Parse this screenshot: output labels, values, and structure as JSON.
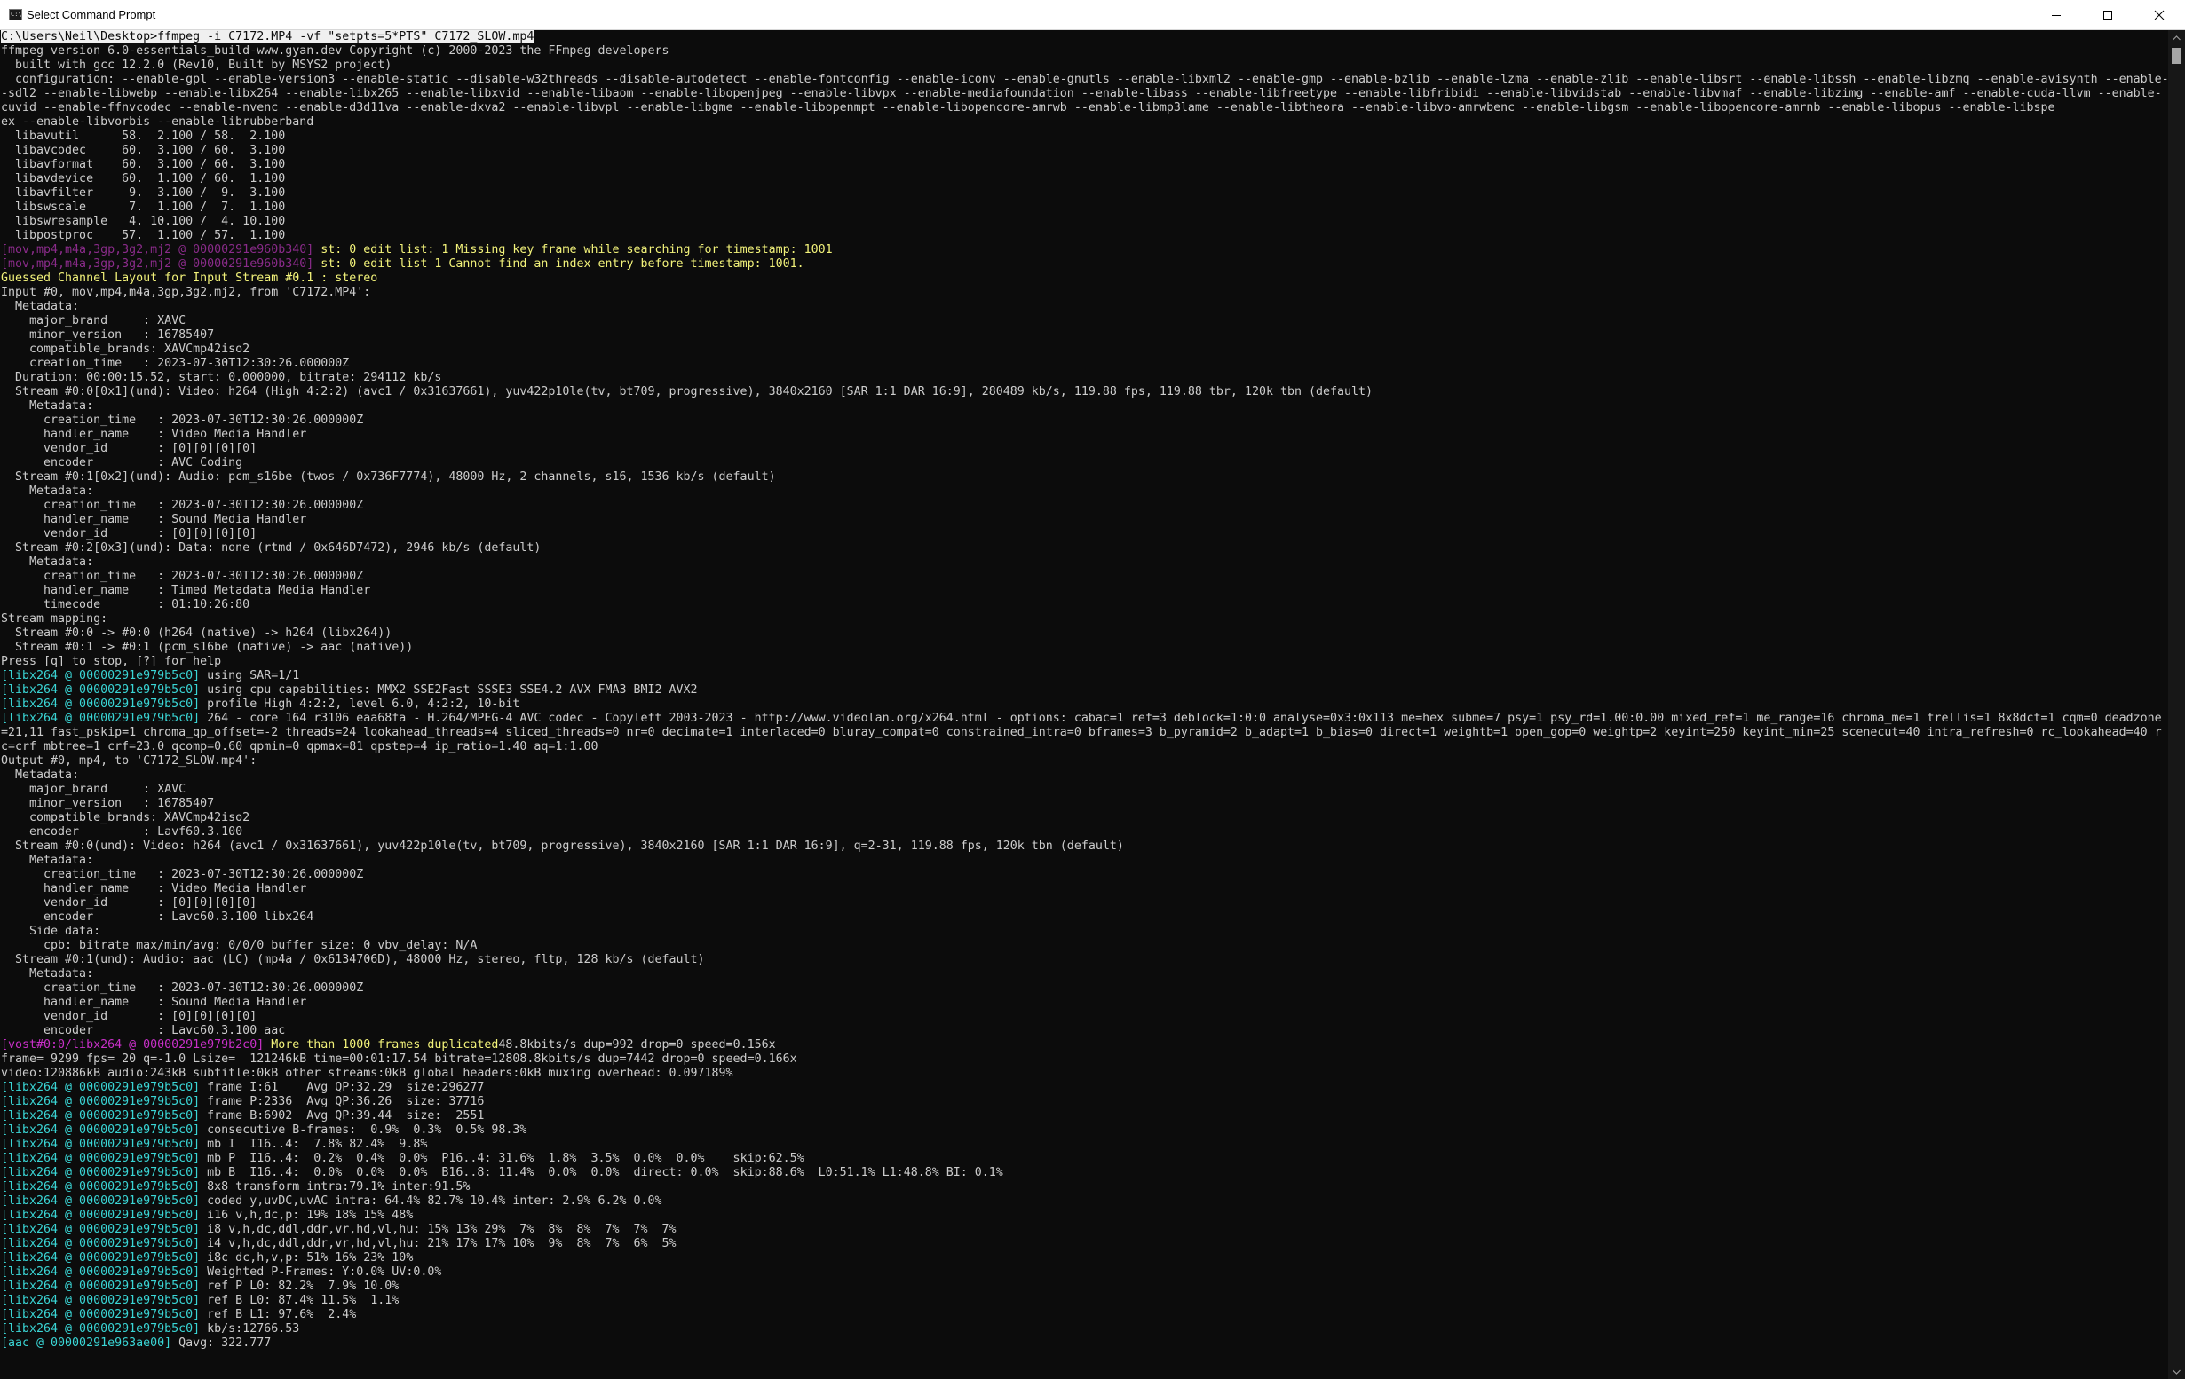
{
  "window": {
    "title": "Select Command Prompt",
    "app_icon_text": "C:\\",
    "icons": {
      "minimize": "minimize-icon",
      "maximize": "maximize-icon",
      "close": "close-icon",
      "scroll_up": "chevron-up-icon",
      "scroll_down": "chevron-down-icon"
    },
    "scrollbar_position_fraction": 0.0
  },
  "colors": {
    "background": "#0c0c0c",
    "text": "#cccccc",
    "tag_cyan": "#3ad5d5",
    "tag_purple": "#8a2b8a",
    "tag_magenta": "#c930c9",
    "warning_yellow": "#f2f27a",
    "selection": "#f0f0f0"
  },
  "console": {
    "lines": [
      [
        {
          "t": "C:\\Users\\Neil\\Desktop>ffmpeg -i C7172.MP4 -vf \"setpts=5*PTS\" C7172_SLOW.mp4",
          "c": "prompt"
        }
      ],
      [
        {
          "t": "ffmpeg version 6.0-essentials_build-www.gyan.dev Copyright (c) 2000-2023 the FFmpeg developers",
          "c": "normal"
        }
      ],
      [
        {
          "t": "  built with gcc 12.2.0 (Rev10, Built by MSYS2 project)",
          "c": "normal"
        }
      ],
      [
        {
          "t": "  configuration: --enable-gpl --enable-version3 --enable-static --disable-w32threads --disable-autodetect --enable-fontconfig --enable-iconv --enable-gnutls --enable-libxml2 --enable-gmp --enable-bzlib --enable-lzma --enable-zlib --enable-libsrt --enable-libssh --enable-libzmq --enable-avisynth --enable-",
          "c": "normal"
        }
      ],
      [
        {
          "t": "-sdl2 --enable-libwebp --enable-libx264 --enable-libx265 --enable-libxvid --enable-libaom --enable-libopenjpeg --enable-libvpx --enable-mediafoundation --enable-libass --enable-libfreetype --enable-libfribidi --enable-libvidstab --enable-libvmaf --enable-libzimg --enable-amf --enable-cuda-llvm --enable-",
          "c": "normal"
        }
      ],
      [
        {
          "t": "cuvid --enable-ffnvcodec --enable-nvenc --enable-d3d11va --enable-dxva2 --enable-libvpl --enable-libgme --enable-libopenmpt --enable-libopencore-amrwb --enable-libmp3lame --enable-libtheora --enable-libvo-amrwbenc --enable-libgsm --enable-libopencore-amrnb --enable-libopus --enable-libspe",
          "c": "normal"
        }
      ],
      [
        {
          "t": "ex --enable-libvorbis --enable-librubberband",
          "c": "normal"
        }
      ],
      [
        {
          "t": "  libavutil      58.  2.100 / 58.  2.100",
          "c": "normal"
        }
      ],
      [
        {
          "t": "  libavcodec     60.  3.100 / 60.  3.100",
          "c": "normal"
        }
      ],
      [
        {
          "t": "  libavformat    60.  3.100 / 60.  3.100",
          "c": "normal"
        }
      ],
      [
        {
          "t": "  libavdevice    60.  1.100 / 60.  1.100",
          "c": "normal"
        }
      ],
      [
        {
          "t": "  libavfilter     9.  3.100 /  9.  3.100",
          "c": "normal"
        }
      ],
      [
        {
          "t": "  libswscale      7.  1.100 /  7.  1.100",
          "c": "normal"
        }
      ],
      [
        {
          "t": "  libswresample   4. 10.100 /  4. 10.100",
          "c": "normal"
        }
      ],
      [
        {
          "t": "  libpostproc    57.  1.100 / 57.  1.100",
          "c": "normal"
        }
      ],
      [
        {
          "t": "[mov,mp4,m4a,3gp,3g2,mj2 @ 00000291e960b340]",
          "c": "purple"
        },
        {
          "t": " st: 0 edit list: 1 Missing key frame while searching for timestamp: 1001",
          "c": "yellow"
        }
      ],
      [
        {
          "t": "[mov,mp4,m4a,3gp,3g2,mj2 @ 00000291e960b340]",
          "c": "purple"
        },
        {
          "t": " st: 0 edit list 1 Cannot find an index entry before timestamp: 1001.",
          "c": "yellow"
        }
      ],
      [
        {
          "t": "Guessed Channel Layout for Input Stream #0.1 : stereo",
          "c": "yellow"
        }
      ],
      [
        {
          "t": "Input #0, mov,mp4,m4a,3gp,3g2,mj2, from 'C7172.MP4':",
          "c": "normal"
        }
      ],
      [
        {
          "t": "  Metadata:",
          "c": "normal"
        }
      ],
      [
        {
          "t": "    major_brand     : XAVC",
          "c": "normal"
        }
      ],
      [
        {
          "t": "    minor_version   : 16785407",
          "c": "normal"
        }
      ],
      [
        {
          "t": "    compatible_brands: XAVCmp42iso2",
          "c": "normal"
        }
      ],
      [
        {
          "t": "    creation_time   : 2023-07-30T12:30:26.000000Z",
          "c": "normal"
        }
      ],
      [
        {
          "t": "  Duration: 00:00:15.52, start: 0.000000, bitrate: 294112 kb/s",
          "c": "normal"
        }
      ],
      [
        {
          "t": "  Stream #0:0[0x1](und): Video: h264 (High 4:2:2) (avc1 / 0x31637661), yuv422p10le(tv, bt709, progressive), 3840x2160 [SAR 1:1 DAR 16:9], 280489 kb/s, 119.88 fps, 119.88 tbr, 120k tbn (default)",
          "c": "normal"
        }
      ],
      [
        {
          "t": "    Metadata:",
          "c": "normal"
        }
      ],
      [
        {
          "t": "      creation_time   : 2023-07-30T12:30:26.000000Z",
          "c": "normal"
        }
      ],
      [
        {
          "t": "      handler_name    : Video Media Handler",
          "c": "normal"
        }
      ],
      [
        {
          "t": "      vendor_id       : [0][0][0][0]",
          "c": "normal"
        }
      ],
      [
        {
          "t": "      encoder         : AVC Coding",
          "c": "normal"
        }
      ],
      [
        {
          "t": "  Stream #0:1[0x2](und): Audio: pcm_s16be (twos / 0x736F7774), 48000 Hz, 2 channels, s16, 1536 kb/s (default)",
          "c": "normal"
        }
      ],
      [
        {
          "t": "    Metadata:",
          "c": "normal"
        }
      ],
      [
        {
          "t": "      creation_time   : 2023-07-30T12:30:26.000000Z",
          "c": "normal"
        }
      ],
      [
        {
          "t": "      handler_name    : Sound Media Handler",
          "c": "normal"
        }
      ],
      [
        {
          "t": "      vendor_id       : [0][0][0][0]",
          "c": "normal"
        }
      ],
      [
        {
          "t": "  Stream #0:2[0x3](und): Data: none (rtmd / 0x646D7472), 2946 kb/s (default)",
          "c": "normal"
        }
      ],
      [
        {
          "t": "    Metadata:",
          "c": "normal"
        }
      ],
      [
        {
          "t": "      creation_time   : 2023-07-30T12:30:26.000000Z",
          "c": "normal"
        }
      ],
      [
        {
          "t": "      handler_name    : Timed Metadata Media Handler",
          "c": "normal"
        }
      ],
      [
        {
          "t": "      timecode        : 01:10:26:80",
          "c": "normal"
        }
      ],
      [
        {
          "t": "Stream mapping:",
          "c": "normal"
        }
      ],
      [
        {
          "t": "  Stream #0:0 -> #0:0 (h264 (native) -> h264 (libx264))",
          "c": "normal"
        }
      ],
      [
        {
          "t": "  Stream #0:1 -> #0:1 (pcm_s16be (native) -> aac (native))",
          "c": "normal"
        }
      ],
      [
        {
          "t": "Press [q] to stop, [?] for help",
          "c": "normal"
        }
      ],
      [
        {
          "t": "[libx264 @ 00000291e979b5c0]",
          "c": "cyan"
        },
        {
          "t": " using SAR=1/1",
          "c": "normal"
        }
      ],
      [
        {
          "t": "[libx264 @ 00000291e979b5c0]",
          "c": "cyan"
        },
        {
          "t": " using cpu capabilities: MMX2 SSE2Fast SSSE3 SSE4.2 AVX FMA3 BMI2 AVX2",
          "c": "normal"
        }
      ],
      [
        {
          "t": "[libx264 @ 00000291e979b5c0]",
          "c": "cyan"
        },
        {
          "t": " profile High 4:2:2, level 6.0, 4:2:2, 10-bit",
          "c": "normal"
        }
      ],
      [
        {
          "t": "[libx264 @ 00000291e979b5c0]",
          "c": "cyan"
        },
        {
          "t": " 264 - core 164 r3106 eaa68fa - H.264/MPEG-4 AVC codec - Copyleft 2003-2023 - http://www.videolan.org/x264.html - options: cabac=1 ref=3 deblock=1:0:0 analyse=0x3:0x113 me=hex subme=7 psy=1 psy_rd=1.00:0.00 mixed_ref=1 me_range=16 chroma_me=1 trellis=1 8x8dct=1 cqm=0 deadzone",
          "c": "normal"
        }
      ],
      [
        {
          "t": "=21,11 fast_pskip=1 chroma_qp_offset=-2 threads=24 lookahead_threads=4 sliced_threads=0 nr=0 decimate=1 interlaced=0 bluray_compat=0 constrained_intra=0 bframes=3 b_pyramid=2 b_adapt=1 b_bias=0 direct=1 weightb=1 open_gop=0 weightp=2 keyint=250 keyint_min=25 scenecut=40 intra_refresh=0 rc_lookahead=40 r",
          "c": "normal"
        }
      ],
      [
        {
          "t": "c=crf mbtree=1 crf=23.0 qcomp=0.60 qpmin=0 qpmax=81 qpstep=4 ip_ratio=1.40 aq=1:1.00",
          "c": "normal"
        }
      ],
      [
        {
          "t": "Output #0, mp4, to 'C7172_SLOW.mp4':",
          "c": "normal"
        }
      ],
      [
        {
          "t": "  Metadata:",
          "c": "normal"
        }
      ],
      [
        {
          "t": "    major_brand     : XAVC",
          "c": "normal"
        }
      ],
      [
        {
          "t": "    minor_version   : 16785407",
          "c": "normal"
        }
      ],
      [
        {
          "t": "    compatible_brands: XAVCmp42iso2",
          "c": "normal"
        }
      ],
      [
        {
          "t": "    encoder         : Lavf60.3.100",
          "c": "normal"
        }
      ],
      [
        {
          "t": "  Stream #0:0(und): Video: h264 (avc1 / 0x31637661), yuv422p10le(tv, bt709, progressive), 3840x2160 [SAR 1:1 DAR 16:9], q=2-31, 119.88 fps, 120k tbn (default)",
          "c": "normal"
        }
      ],
      [
        {
          "t": "    Metadata:",
          "c": "normal"
        }
      ],
      [
        {
          "t": "      creation_time   : 2023-07-30T12:30:26.000000Z",
          "c": "normal"
        }
      ],
      [
        {
          "t": "      handler_name    : Video Media Handler",
          "c": "normal"
        }
      ],
      [
        {
          "t": "      vendor_id       : [0][0][0][0]",
          "c": "normal"
        }
      ],
      [
        {
          "t": "      encoder         : Lavc60.3.100 libx264",
          "c": "normal"
        }
      ],
      [
        {
          "t": "    Side data:",
          "c": "normal"
        }
      ],
      [
        {
          "t": "      cpb: bitrate max/min/avg: 0/0/0 buffer size: 0 vbv_delay: N/A",
          "c": "normal"
        }
      ],
      [
        {
          "t": "  Stream #0:1(und): Audio: aac (LC) (mp4a / 0x6134706D), 48000 Hz, stereo, fltp, 128 kb/s (default)",
          "c": "normal"
        }
      ],
      [
        {
          "t": "    Metadata:",
          "c": "normal"
        }
      ],
      [
        {
          "t": "      creation_time   : 2023-07-30T12:30:26.000000Z",
          "c": "normal"
        }
      ],
      [
        {
          "t": "      handler_name    : Sound Media Handler",
          "c": "normal"
        }
      ],
      [
        {
          "t": "      vendor_id       : [0][0][0][0]",
          "c": "normal"
        }
      ],
      [
        {
          "t": "      encoder         : Lavc60.3.100 aac",
          "c": "normal"
        }
      ],
      [
        {
          "t": "[vost#0:0/libx264 @ 00000291e979b2c0]",
          "c": "magenta"
        },
        {
          "t": " More than 1000 frames duplicated",
          "c": "yellow"
        },
        {
          "t": "48.8kbits/s dup=992 drop=0 speed=0.156x",
          "c": "normal"
        }
      ],
      [
        {
          "t": "frame= 9299 fps= 20 q=-1.0 Lsize=  121246kB time=00:01:17.54 bitrate=12808.8kbits/s dup=7442 drop=0 speed=0.166x",
          "c": "normal"
        }
      ],
      [
        {
          "t": "video:120886kB audio:243kB subtitle:0kB other streams:0kB global headers:0kB muxing overhead: 0.097189%",
          "c": "normal"
        }
      ],
      [
        {
          "t": "[libx264 @ 00000291e979b5c0]",
          "c": "cyan"
        },
        {
          "t": " frame I:61    Avg QP:32.29  size:296277",
          "c": "normal"
        }
      ],
      [
        {
          "t": "[libx264 @ 00000291e979b5c0]",
          "c": "cyan"
        },
        {
          "t": " frame P:2336  Avg QP:36.26  size: 37716",
          "c": "normal"
        }
      ],
      [
        {
          "t": "[libx264 @ 00000291e979b5c0]",
          "c": "cyan"
        },
        {
          "t": " frame B:6902  Avg QP:39.44  size:  2551",
          "c": "normal"
        }
      ],
      [
        {
          "t": "[libx264 @ 00000291e979b5c0]",
          "c": "cyan"
        },
        {
          "t": " consecutive B-frames:  0.9%  0.3%  0.5% 98.3%",
          "c": "normal"
        }
      ],
      [
        {
          "t": "[libx264 @ 00000291e979b5c0]",
          "c": "cyan"
        },
        {
          "t": " mb I  I16..4:  7.8% 82.4%  9.8%",
          "c": "normal"
        }
      ],
      [
        {
          "t": "[libx264 @ 00000291e979b5c0]",
          "c": "cyan"
        },
        {
          "t": " mb P  I16..4:  0.2%  0.4%  0.0%  P16..4: 31.6%  1.8%  3.5%  0.0%  0.0%    skip:62.5%",
          "c": "normal"
        }
      ],
      [
        {
          "t": "[libx264 @ 00000291e979b5c0]",
          "c": "cyan"
        },
        {
          "t": " mb B  I16..4:  0.0%  0.0%  0.0%  B16..8: 11.4%  0.0%  0.0%  direct: 0.0%  skip:88.6%  L0:51.1% L1:48.8% BI: 0.1%",
          "c": "normal"
        }
      ],
      [
        {
          "t": "[libx264 @ 00000291e979b5c0]",
          "c": "cyan"
        },
        {
          "t": " 8x8 transform intra:79.1% inter:91.5%",
          "c": "normal"
        }
      ],
      [
        {
          "t": "[libx264 @ 00000291e979b5c0]",
          "c": "cyan"
        },
        {
          "t": " coded y,uvDC,uvAC intra: 64.4% 82.7% 10.4% inter: 2.9% 6.2% 0.0%",
          "c": "normal"
        }
      ],
      [
        {
          "t": "[libx264 @ 00000291e979b5c0]",
          "c": "cyan"
        },
        {
          "t": " i16 v,h,dc,p: 19% 18% 15% 48%",
          "c": "normal"
        }
      ],
      [
        {
          "t": "[libx264 @ 00000291e979b5c0]",
          "c": "cyan"
        },
        {
          "t": " i8 v,h,dc,ddl,ddr,vr,hd,vl,hu: 15% 13% 29%  7%  8%  8%  7%  7%  7%",
          "c": "normal"
        }
      ],
      [
        {
          "t": "[libx264 @ 00000291e979b5c0]",
          "c": "cyan"
        },
        {
          "t": " i4 v,h,dc,ddl,ddr,vr,hd,vl,hu: 21% 17% 17% 10%  9%  8%  7%  6%  5%",
          "c": "normal"
        }
      ],
      [
        {
          "t": "[libx264 @ 00000291e979b5c0]",
          "c": "cyan"
        },
        {
          "t": " i8c dc,h,v,p: 51% 16% 23% 10%",
          "c": "normal"
        }
      ],
      [
        {
          "t": "[libx264 @ 00000291e979b5c0]",
          "c": "cyan"
        },
        {
          "t": " Weighted P-Frames: Y:0.0% UV:0.0%",
          "c": "normal"
        }
      ],
      [
        {
          "t": "[libx264 @ 00000291e979b5c0]",
          "c": "cyan"
        },
        {
          "t": " ref P L0: 82.2%  7.9% 10.0%",
          "c": "normal"
        }
      ],
      [
        {
          "t": "[libx264 @ 00000291e979b5c0]",
          "c": "cyan"
        },
        {
          "t": " ref B L0: 87.4% 11.5%  1.1%",
          "c": "normal"
        }
      ],
      [
        {
          "t": "[libx264 @ 00000291e979b5c0]",
          "c": "cyan"
        },
        {
          "t": " ref B L1: 97.6%  2.4%",
          "c": "normal"
        }
      ],
      [
        {
          "t": "[libx264 @ 00000291e979b5c0]",
          "c": "cyan"
        },
        {
          "t": " kb/s:12766.53",
          "c": "normal"
        }
      ],
      [
        {
          "t": "[aac @ 00000291e963ae00]",
          "c": "cyan"
        },
        {
          "t": " Qavg: 322.777",
          "c": "normal"
        }
      ]
    ]
  }
}
